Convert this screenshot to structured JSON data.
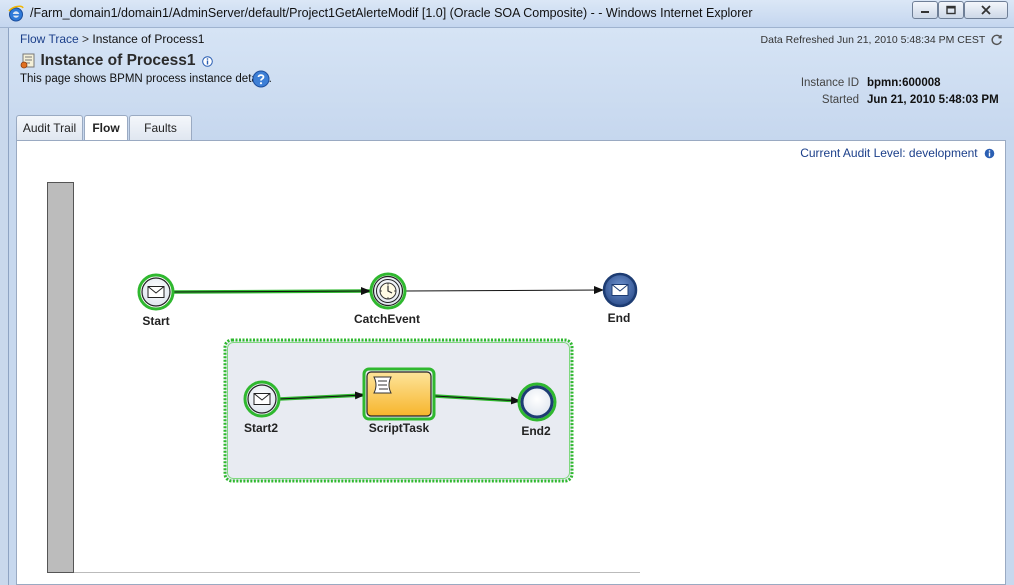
{
  "window": {
    "title": "/Farm_domain1/domain1/AdminServer/default/Project1GetAlerteModif [1.0] (Oracle SOA Composite) - - Windows Internet Explorer",
    "icons": [
      "ie-logo-icon",
      "minimize-icon",
      "maximize-icon",
      "close-icon"
    ]
  },
  "header": {
    "breadcrumb": {
      "link": "Flow Trace",
      "separator": ">",
      "current": "Instance of Process1"
    },
    "refreshed": "Data Refreshed Jun 21, 2010 5:48:34 PM CEST",
    "title": "Instance of Process1",
    "description": "This page shows BPMN process instance details.",
    "instance_id_label": "Instance ID",
    "instance_id": "bpmn:600008",
    "started_label": "Started",
    "started": "Jun 21, 2010 5:48:03 PM"
  },
  "tabs": [
    {
      "label": "Audit Trail",
      "selected": false
    },
    {
      "label": "Flow",
      "selected": true
    },
    {
      "label": "Faults",
      "selected": false
    }
  ],
  "panel": {
    "audit_level": "Current Audit Level: development"
  },
  "diagram": {
    "nodes": [
      {
        "label": "Start",
        "kind": "message-start-event",
        "icon": "envelope-icon"
      },
      {
        "label": "CatchEvent",
        "kind": "timer-catch-event",
        "icon": "clock-icon"
      },
      {
        "label": "End",
        "kind": "message-end-event",
        "icon": "envelope-icon"
      },
      {
        "label": "Start2",
        "kind": "message-start-event",
        "icon": "envelope-icon"
      },
      {
        "label": "ScriptTask",
        "kind": "script-task",
        "icon": "script-icon"
      },
      {
        "label": "End2",
        "kind": "end-event",
        "icon": ""
      }
    ],
    "colors": {
      "executed": "#2fb82f",
      "subprocess_fill": "#e8ebf2",
      "task_fill": "#fbc84a",
      "end_fill": "#3b63a6"
    }
  }
}
